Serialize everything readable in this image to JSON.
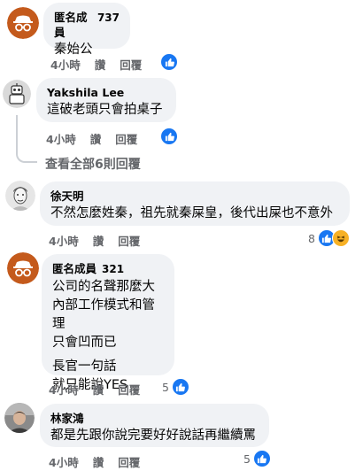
{
  "comments": [
    {
      "author": "匿名成員",
      "badge": "737",
      "lines": [
        "秦始公"
      ],
      "time": "4小時",
      "like": "讚",
      "reply": "回覆",
      "reaction_count": ""
    },
    {
      "author": "Yakshila Lee",
      "badge": "",
      "lines": [
        "這破老頭只會拍桌子"
      ],
      "time": "4小時",
      "like": "讚",
      "reply": "回覆",
      "reaction_count": ""
    },
    {
      "author": "徐天明",
      "badge": "",
      "lines": [
        "不然怎麼姓秦，祖先就秦屎皇，後代出屎也不意外"
      ],
      "time": "4小時",
      "like": "讚",
      "reply": "回覆",
      "reaction_count": "8"
    },
    {
      "author": "匿名成員",
      "badge": "321",
      "lines": [
        "公司的名聲那麼大",
        "內部工作模式和管理",
        "只會凹而已"
      ],
      "lines2": [
        "長官一句話",
        "就只能說YES"
      ],
      "time": "4小時",
      "like": "讚",
      "reply": "回覆",
      "reaction_count": "5"
    },
    {
      "author": "林家鴻",
      "badge": "",
      "lines": [
        "都是先跟你說完要好好說話再繼續罵"
      ],
      "time": "4小時",
      "like": "讚",
      "reply": "回覆",
      "reaction_count": "5"
    }
  ],
  "view_replies": "查看全部6則回覆",
  "colors": {
    "like_blue": "#1877f2",
    "haha_yellow": "#f7b125",
    "bubble": "#f0f2f5",
    "anon_avatar": "#c45a1c"
  }
}
